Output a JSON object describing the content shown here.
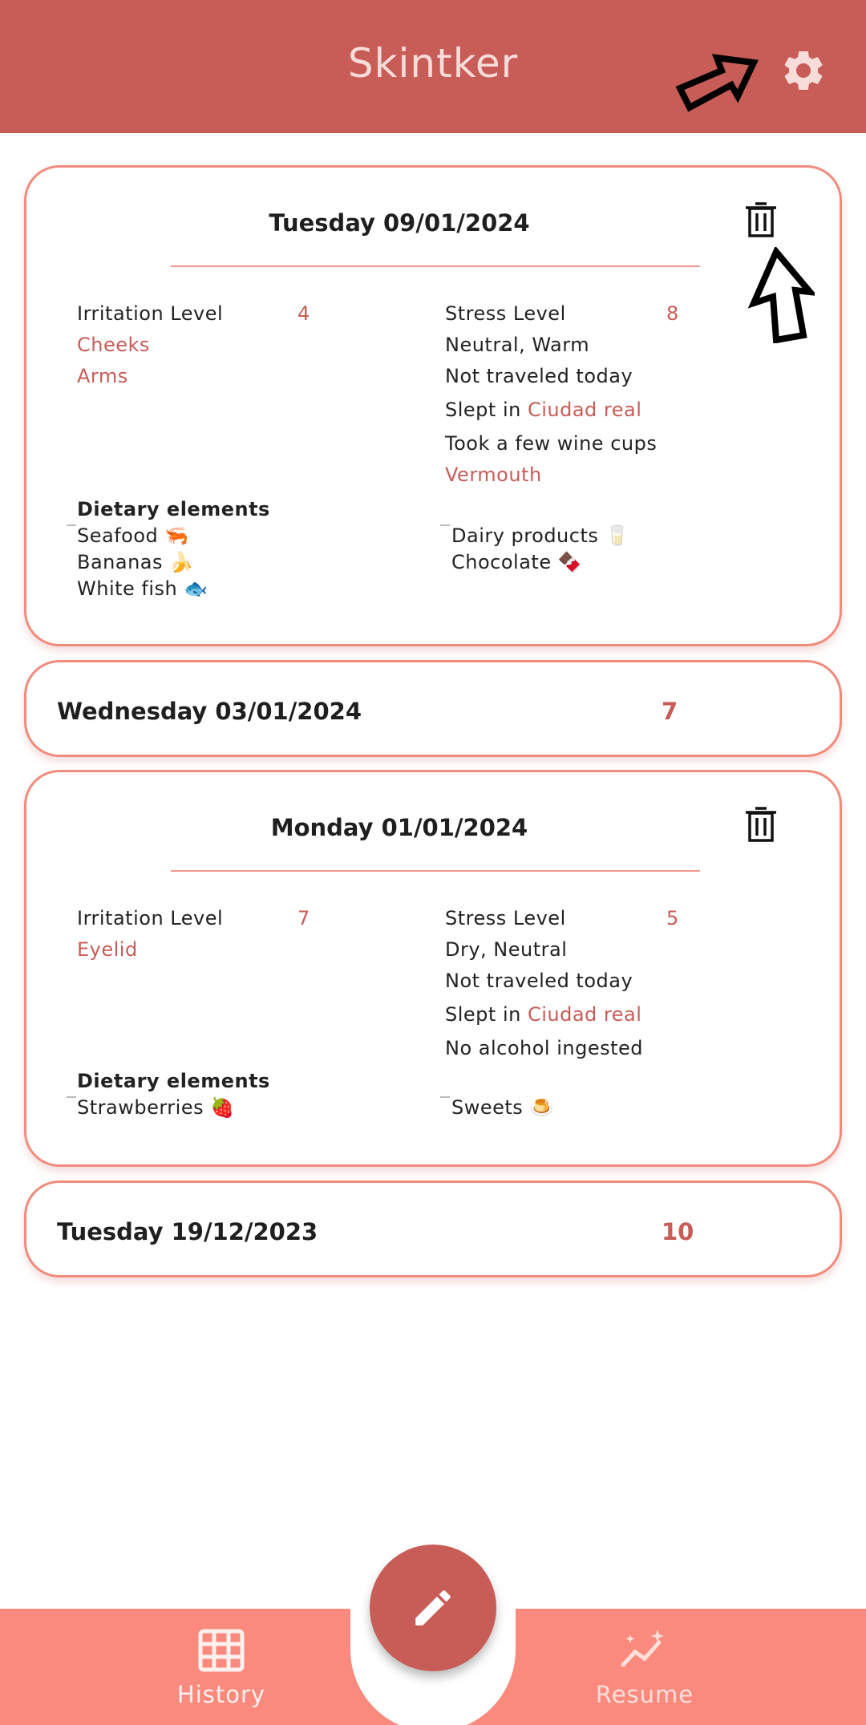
{
  "app": {
    "title": "Skintker"
  },
  "colors": {
    "primary": "#c85c57",
    "card_border": "#f18b7d",
    "nav_bg": "#fb8a7e"
  },
  "entries": [
    {
      "date": "Tuesday 09/01/2024",
      "expanded": true,
      "irritation_label": "Irritation Level",
      "irritation_value": "4",
      "zones": [
        "Cheeks",
        "Arms"
      ],
      "stress_label": "Stress Level",
      "stress_value": "8",
      "weather": "Neutral, Warm",
      "travel": "Not traveled today",
      "slept_prefix": "Slept in",
      "slept_city": "Ciudad real",
      "alcohol": "Took a few wine cups",
      "alcohol_type": "Vermouth",
      "diet_title": "Dietary elements",
      "diet_left": [
        "Seafood 🦐",
        "Bananas 🍌",
        "White fish 🐟"
      ],
      "diet_right": [
        "Dairy products 🥛",
        "Chocolate 🍫"
      ]
    },
    {
      "date": "Wednesday 03/01/2024",
      "expanded": false,
      "value": "7"
    },
    {
      "date": "Monday 01/01/2024",
      "expanded": true,
      "irritation_label": "Irritation Level",
      "irritation_value": "7",
      "zones": [
        "Eyelid"
      ],
      "stress_label": "Stress Level",
      "stress_value": "5",
      "weather": "Dry, Neutral",
      "travel": "Not traveled today",
      "slept_prefix": "Slept in",
      "slept_city": "Ciudad real",
      "alcohol": "No alcohol ingested",
      "diet_title": "Dietary elements",
      "diet_left": [
        "Strawberries 🍓"
      ],
      "diet_right": [
        "Sweets 🍮"
      ]
    },
    {
      "date": "Tuesday 19/12/2023",
      "expanded": false,
      "value": "10"
    }
  ],
  "nav": {
    "history_label": "History",
    "resume_label": "Resume",
    "history_icon": "grid-icon",
    "resume_icon": "sparkle-chart-icon",
    "fab_icon": "pencil-icon"
  }
}
